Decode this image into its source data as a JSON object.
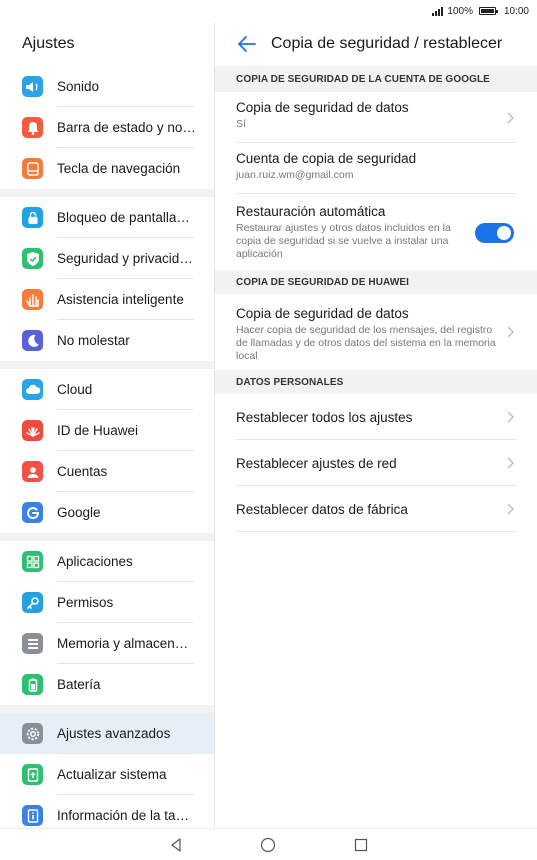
{
  "status": {
    "battery": "100%",
    "time": "10:00"
  },
  "left": {
    "title": "Ajustes",
    "groups": [
      [
        {
          "label": "Sonido",
          "icon": "speaker-icon",
          "color": "#2aa3e8"
        },
        {
          "label": "Barra de estado y no…",
          "icon": "bell-icon",
          "color": "#f35b3f"
        },
        {
          "label": "Tecla de navegación",
          "icon": "navigation-key-icon",
          "color": "#f47b3a"
        }
      ],
      [
        {
          "label": "Bloqueo de pantalla…",
          "icon": "lock-icon",
          "color": "#1fa3e3"
        },
        {
          "label": "Seguridad y privacid…",
          "icon": "shield-icon",
          "color": "#2fbf71"
        },
        {
          "label": "Asistencia inteligente",
          "icon": "hand-icon",
          "color": "#f47b3a"
        },
        {
          "label": "No molestar",
          "icon": "moon-icon",
          "color": "#5b61d9"
        }
      ],
      [
        {
          "label": "Cloud",
          "icon": "cloud-icon",
          "color": "#27a5e6"
        },
        {
          "label": "ID de Huawei",
          "icon": "huawei-icon",
          "color": "#ef4a3c"
        },
        {
          "label": "Cuentas",
          "icon": "person-icon",
          "color": "#f15146"
        },
        {
          "label": "Google",
          "icon": "google-icon",
          "color": "#3b82e6"
        }
      ],
      [
        {
          "label": "Aplicaciones",
          "icon": "apps-icon",
          "color": "#2fbf71"
        },
        {
          "label": "Permisos",
          "icon": "key-icon",
          "color": "#24a0e0"
        },
        {
          "label": "Memoria y almacen…",
          "icon": "storage-icon",
          "color": "#8a8f99"
        },
        {
          "label": "Batería",
          "icon": "battery-icon",
          "color": "#2fbf71"
        }
      ],
      [
        {
          "label": "Ajustes avanzados",
          "icon": "gear-icon",
          "color": "#8a8f99",
          "selected": true
        },
        {
          "label": "Actualizar sistema",
          "icon": "update-icon",
          "color": "#2fbf71"
        },
        {
          "label": "Información de la ta…",
          "icon": "info-icon",
          "color": "#3b82e6"
        }
      ]
    ]
  },
  "right": {
    "title": "Copia de seguridad / restablecer",
    "section_google": "COPIA DE SEGURIDAD DE LA CUENTA DE GOOGLE",
    "backup_data_title": "Copia de seguridad de datos",
    "backup_data_value": "Sí",
    "backup_account_title": "Cuenta de copia de seguridad",
    "backup_account_value": "juan.ruiz.wm@gmail.com",
    "auto_restore_title": "Restauración automática",
    "auto_restore_desc": "Restaurar ajustes y otros datos incluidos en la copia de seguridad si se vuelve a instalar una aplicación",
    "auto_restore_on": true,
    "section_huawei": "COPIA DE SEGURIDAD DE HUAWEI",
    "huawei_backup_title": "Copia de seguridad de datos",
    "huawei_backup_desc": "Hacer copia de seguridad de los mensajes, del registro de llamadas y de otros datos del sistema en la memoria local",
    "section_personal": "DATOS PERSONALES",
    "reset_all": "Restablecer todos los ajustes",
    "reset_network": "Restablecer ajustes de red",
    "reset_factory": "Restablecer datos de fábrica"
  },
  "colors": {
    "accent": "#1a73e8",
    "selected_bg": "#e6eef7"
  }
}
